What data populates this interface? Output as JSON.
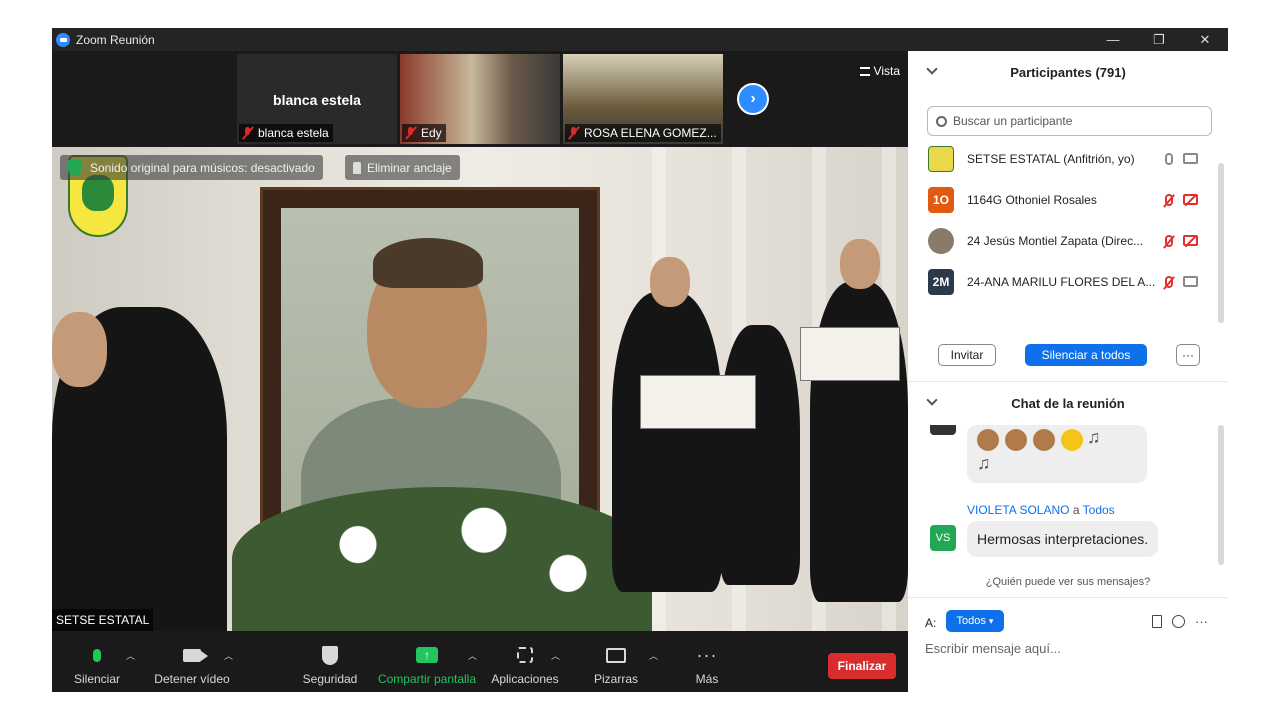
{
  "window": {
    "title": "Zoom Reunión",
    "controls": [
      "—",
      "❐",
      "✕"
    ]
  },
  "thumbnails": [
    {
      "big_name": "blanca estela",
      "label": "blanca estela"
    },
    {
      "big_name": "",
      "label": "Edy"
    },
    {
      "big_name": "",
      "label": "ROSA ELENA GOMEZ..."
    }
  ],
  "view": {
    "label": "Vista"
  },
  "main_video": {
    "original_sound": "Sonido original para músicos: desactivado",
    "unpin": "Eliminar anclaje",
    "speaker_name": "SETSE ESTATAL"
  },
  "toolbar": {
    "mute": "Silenciar",
    "video": "Detener vídeo",
    "security": "Seguridad",
    "share": "Compartir pantalla",
    "apps": "Aplicaciones",
    "boards": "Pizarras",
    "more": "Más",
    "end": "Finalizar"
  },
  "participants": {
    "title": "Participantes (791)",
    "search_placeholder": "Buscar un participante",
    "list": [
      {
        "initials": "",
        "name": "SETSE ESTATAL (Anfitrión, yo)",
        "avatar_color": "#e8d84a",
        "mic_off": false,
        "cam_off": false
      },
      {
        "initials": "1O",
        "name": "1164G Othoniel Rosales",
        "avatar_color": "#e05a10",
        "mic_off": true,
        "cam_off": true
      },
      {
        "initials": "",
        "name": "24 Jesús Montiel Zapata (Direc...",
        "avatar_color": "#8a7a6a",
        "mic_off": true,
        "cam_off": true
      },
      {
        "initials": "2M",
        "name": "24-ANA MARILU FLORES DEL A...",
        "avatar_color": "#2a3a4a",
        "mic_off": true,
        "cam_off": false
      }
    ],
    "invite": "Invitar",
    "mute_all": "Silenciar a todos",
    "more": "···"
  },
  "chat": {
    "title": "Chat de la reunión",
    "last_sender": "VIOLETA SOLANO",
    "to_word": "a",
    "to_target": "Todos",
    "last_sender_initials": "VS",
    "last_message": "Hermosas interpretaciones.",
    "who_sees": "¿Quién puede ver sus mensajes?",
    "to_label": "A:",
    "to_select": "Todos",
    "compose_placeholder": "Escribir mensaje aquí...",
    "more": "···"
  },
  "colors": {
    "accent": "#0e71eb",
    "end": "#d92d2d",
    "green": "#22c55e"
  }
}
